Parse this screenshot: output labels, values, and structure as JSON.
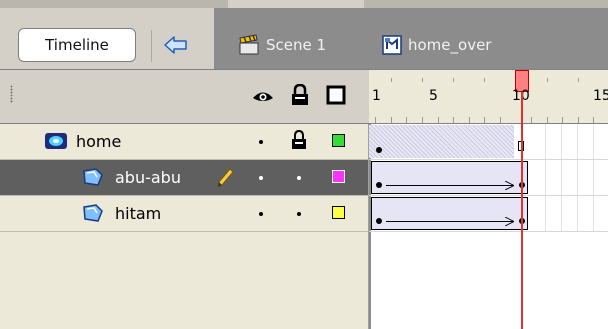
{
  "toolbar": {
    "timeline_label": "Timeline",
    "back_icon": "left-arrow-icon",
    "breadcrumbs": [
      {
        "label": "Scene 1",
        "icon": "clapperboard-icon"
      },
      {
        "label": "home_over",
        "icon": "symbol-icon"
      }
    ]
  },
  "layers_header": {
    "icons": [
      "eye-icon",
      "lock-icon",
      "outline-icon"
    ]
  },
  "layers": [
    {
      "name": "home",
      "type": "folder",
      "selected": false,
      "locked": true,
      "color": "#33dd33"
    },
    {
      "name": "abu-abu",
      "type": "layer",
      "selected": true,
      "editing": true,
      "locked": false,
      "color": "#ff33ff"
    },
    {
      "name": "hitam",
      "type": "layer",
      "selected": false,
      "locked": false,
      "color": "#ffff44"
    }
  ],
  "ruler": {
    "labels": [
      "1",
      "5",
      "10",
      "15"
    ],
    "current_frame": 10
  },
  "colors": {
    "playhead": "#e03030",
    "tween_fill": "#e5e5f6",
    "selected_row": "#5f5f5f"
  }
}
